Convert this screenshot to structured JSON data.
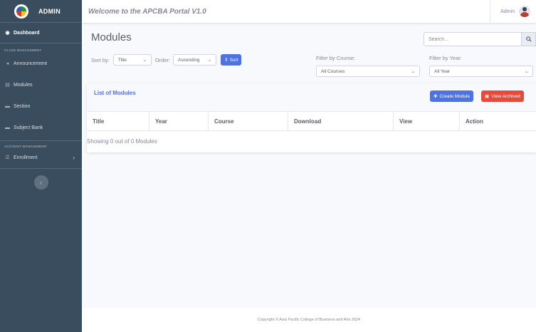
{
  "sidebar": {
    "brand": "ADMIN",
    "dashboard": "Dashboard",
    "section_class": "CLASS MANAGEMENT",
    "announcement": "Announcement",
    "modules": "Modules",
    "section_item": "Section",
    "subject_bank": "Subject Bank",
    "section_account": "ACCOUNT MANAGEMENT",
    "enrollment": "Enrollment"
  },
  "topbar": {
    "welcome": "Welcome to the APCBA Portal V1.0",
    "user": "Admin"
  },
  "main": {
    "title": "Modules",
    "search_placeholder": "Search...",
    "sort_by_label": "Sort by:",
    "sort_by_value": "Title",
    "order_label": "Order:",
    "order_value": "Ascending",
    "sort_button": "Sort",
    "filter_course_label": "Filter by Course:",
    "filter_course_value": "All Courses",
    "filter_year_label": "Filter by Year:",
    "filter_year_value": "All Year"
  },
  "card": {
    "title": "List of Modules",
    "create_button": "Create Module",
    "archived_button": "View Archived",
    "columns": [
      "Title",
      "Year",
      "Course",
      "Download",
      "View",
      "Action"
    ],
    "showing": "Showing 0 out of 0 Modules"
  },
  "footer": "Copyright © Asia Pacific College of Business and Arts 2024",
  "colors": {
    "sidebar": "#3a4d5f",
    "primary": "#4e73df",
    "danger": "#e74a3b"
  }
}
